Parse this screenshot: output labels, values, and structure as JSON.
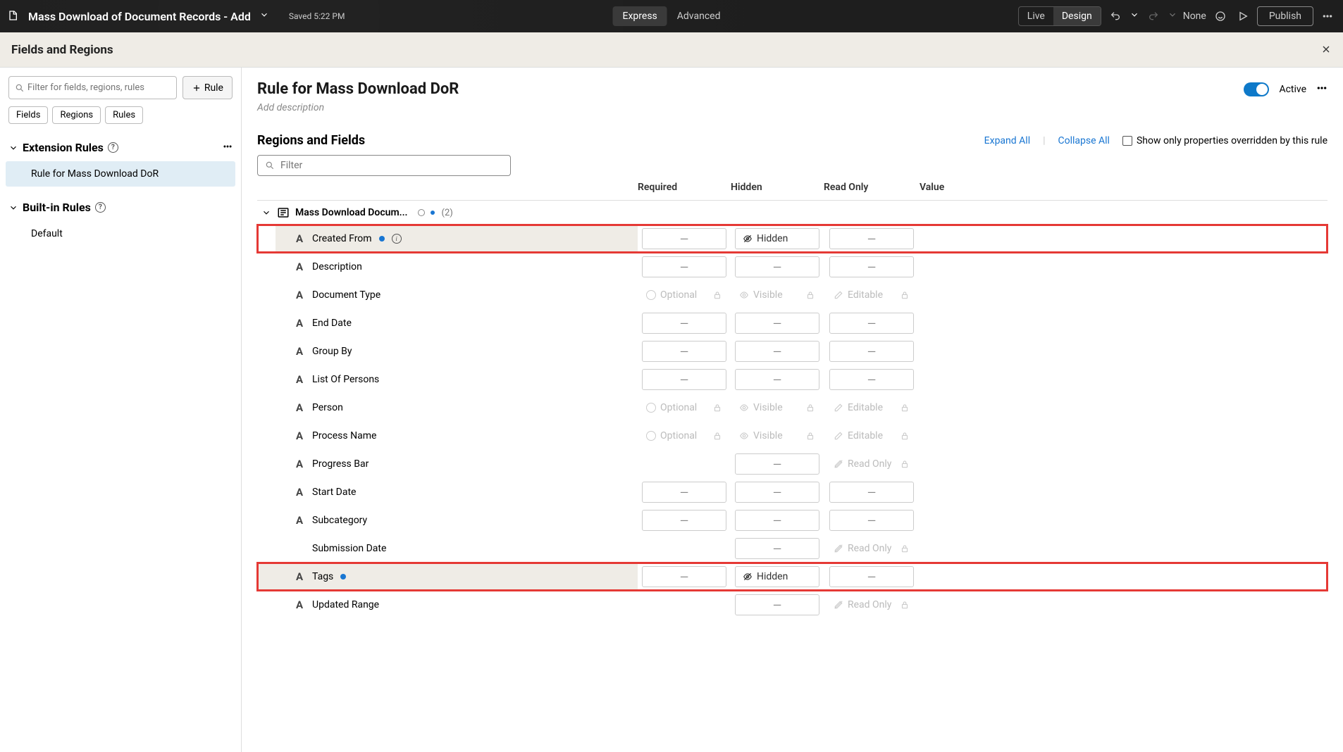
{
  "topbar": {
    "title": "Mass Download of Document Records - Add",
    "saved": "Saved 5:22 PM",
    "express": "Express",
    "advanced": "Advanced",
    "live": "Live",
    "design": "Design",
    "none": "None",
    "publish": "Publish"
  },
  "subheader": {
    "title": "Fields and Regions"
  },
  "sidebar": {
    "filter_placeholder": "Filter for fields, regions, rules",
    "rule_btn": "Rule",
    "tabs": {
      "fields": "Fields",
      "regions": "Regions",
      "rules": "Rules"
    },
    "extension_rules": "Extension Rules",
    "builtin_rules": "Built-in Rules",
    "rule_item": "Rule for Mass Download DoR",
    "default_item": "Default"
  },
  "main": {
    "rule_title": "Rule for Mass Download DoR",
    "active_label": "Active",
    "desc_placeholder": "Add description",
    "regions_title": "Regions and Fields",
    "expand": "Expand All",
    "collapse": "Collapse All",
    "show_overridden": "Show only properties overridden by this rule",
    "filter_placeholder": "Filter",
    "cols": {
      "required": "Required",
      "hidden": "Hidden",
      "readonly": "Read Only",
      "value": "Value"
    },
    "group_name": "Mass Download Docum...",
    "group_count": "(2)",
    "placeholders": {
      "optional": "Optional",
      "visible": "Visible",
      "editable": "Editable",
      "readonly": "Read Only",
      "hidden": "Hidden"
    },
    "fields": [
      {
        "name": "Created From",
        "dot": true,
        "info": true,
        "highlight": true,
        "req": "dash",
        "hid": "hidden",
        "ro": "dash",
        "val": ""
      },
      {
        "name": "Description",
        "req": "dash",
        "hid": "dash",
        "ro": "dash"
      },
      {
        "name": "Document Type",
        "req": "optional",
        "hid": "visible",
        "ro": "editable"
      },
      {
        "name": "End Date",
        "req": "dash",
        "hid": "dash",
        "ro": "dash"
      },
      {
        "name": "Group By",
        "req": "dash",
        "hid": "dash",
        "ro": "dash"
      },
      {
        "name": "List Of Persons",
        "req": "dash",
        "hid": "dash",
        "ro": "dash"
      },
      {
        "name": "Person",
        "req": "optional",
        "hid": "visible",
        "ro": "editable"
      },
      {
        "name": "Process Name",
        "req": "optional",
        "hid": "visible",
        "ro": "editable"
      },
      {
        "name": "Progress Bar",
        "req": "",
        "hid": "dash",
        "ro": "readonly"
      },
      {
        "name": "Start Date",
        "req": "dash",
        "hid": "dash",
        "ro": "dash"
      },
      {
        "name": "Subcategory",
        "req": "dash",
        "hid": "dash",
        "ro": "dash"
      },
      {
        "name": "Submission Date",
        "notype": true,
        "req": "",
        "hid": "dash",
        "ro": "readonly"
      },
      {
        "name": "Tags",
        "dot": true,
        "highlight": true,
        "second": true,
        "req": "dash",
        "hid": "hidden",
        "ro": "dash"
      },
      {
        "name": "Updated Range",
        "req": "",
        "hid": "dash",
        "ro": "readonly"
      }
    ]
  }
}
